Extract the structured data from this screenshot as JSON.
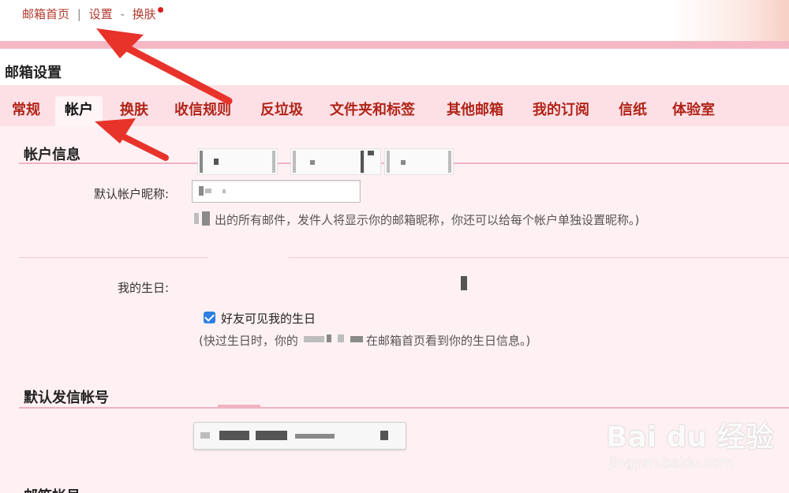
{
  "topbar": {
    "home_link": "邮箱首页",
    "separator1": "|",
    "settings_link": "设置",
    "separator2": "-",
    "skin_link": "换肤"
  },
  "page_title": "邮箱设置",
  "tabs": [
    {
      "label": "常规"
    },
    {
      "label": "帐户"
    },
    {
      "label": "换肤"
    },
    {
      "label": "收信规则"
    },
    {
      "label": "反垃圾"
    },
    {
      "label": "文件夹和标签"
    },
    {
      "label": "其他邮箱"
    },
    {
      "label": "我的订阅"
    },
    {
      "label": "信纸"
    },
    {
      "label": "体验室"
    }
  ],
  "active_tab": "帐户",
  "account_info": {
    "title": "帐户信息",
    "nickname_label": "默认帐户昵称:",
    "nickname_hint": "出的所有邮件，发件人将显示你的邮箱昵称，你还可以给每个帐户单独设置昵称。)"
  },
  "birthday": {
    "label": "我的生日:",
    "friends_visible_label": "好友可见我的生日",
    "friends_visible_checked": true,
    "hint_start": "(快过生日时，你的",
    "hint_end": "在邮箱首页看到你的生日信息。)"
  },
  "default_sender": {
    "title": "默认发信帐号"
  },
  "next_section_partial": "邮箱帐号",
  "watermark": {
    "logo": "Bai du 经验",
    "url": "jingyan.baidu.com"
  },
  "colors": {
    "accent_red": "#b02418",
    "tab_bar_bg": "#fde0e6",
    "content_bg": "#fff1f3",
    "pink_band": "#f6b7c5",
    "checkbox_blue": "#2d7fe3",
    "annotation_arrow": "#e8332a"
  },
  "icons": {
    "notification_dot": "red-dot-icon",
    "checkbox": "checkbox-checked-icon"
  }
}
